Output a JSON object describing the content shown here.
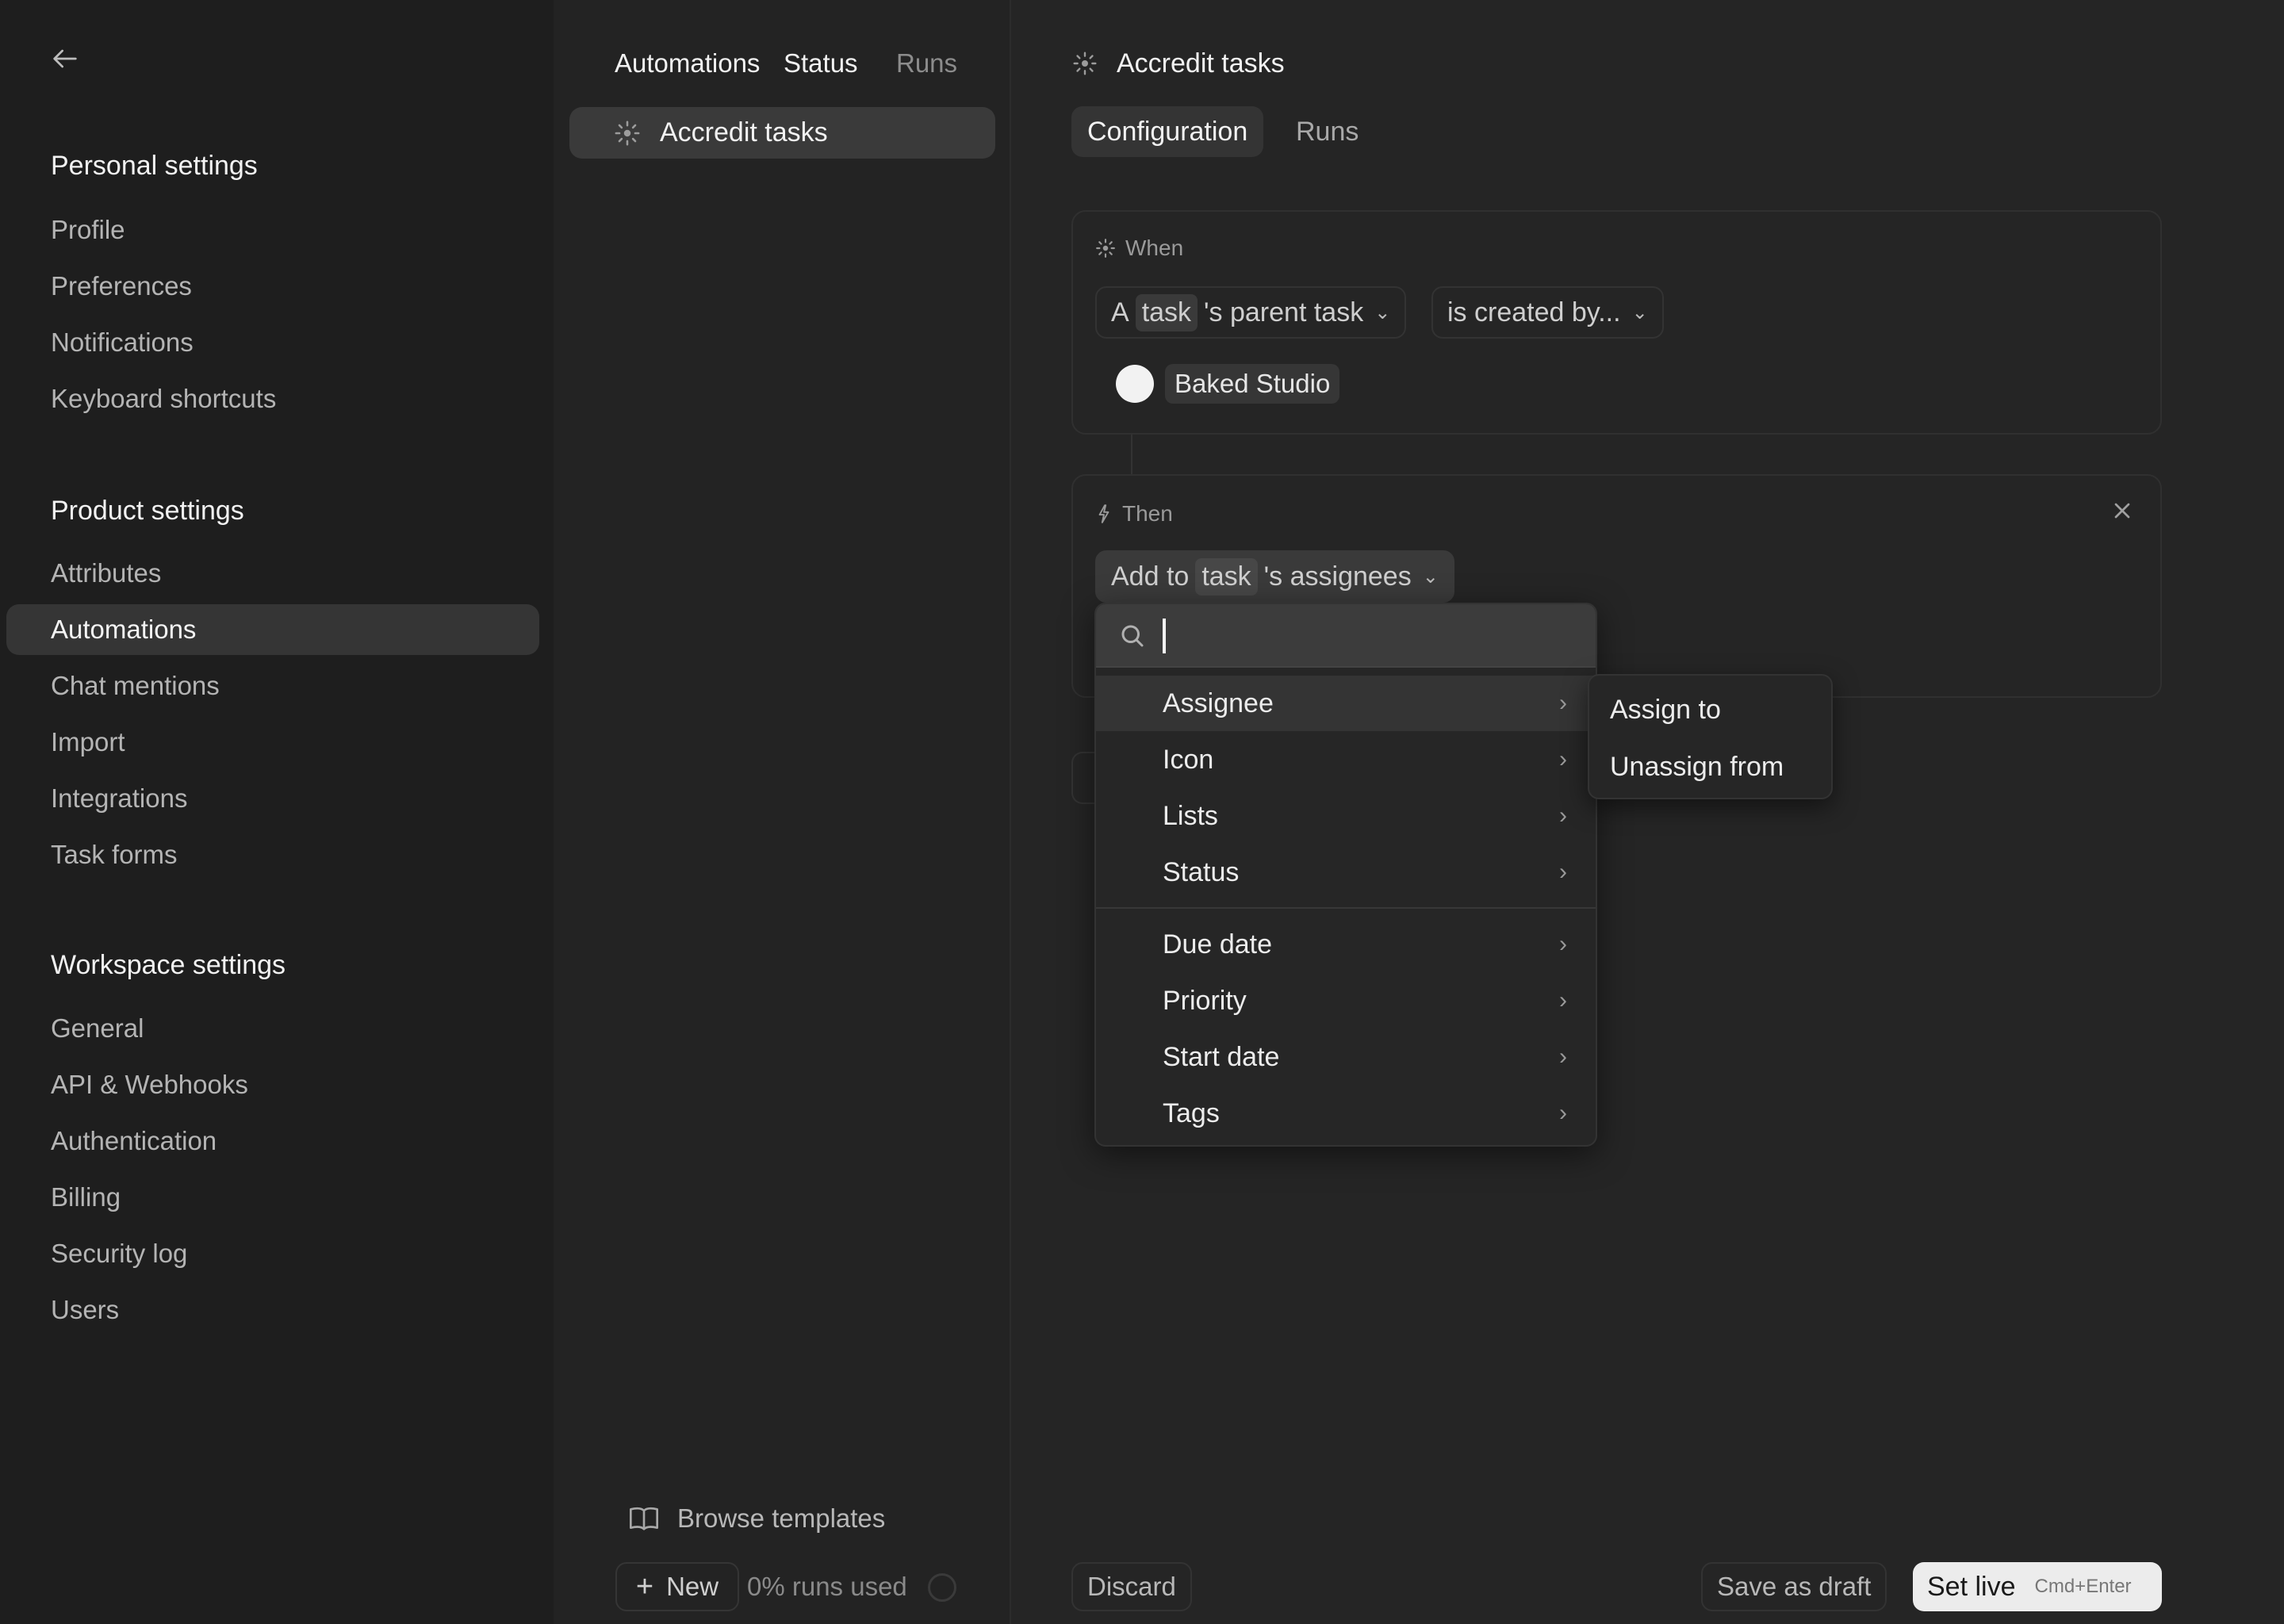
{
  "left_nav": {
    "back_label": "Back",
    "sections": [
      {
        "title": "Personal settings",
        "items": [
          {
            "label": "Profile",
            "active": false
          },
          {
            "label": "Preferences",
            "active": false
          },
          {
            "label": "Notifications",
            "active": false
          },
          {
            "label": "Keyboard shortcuts",
            "active": false
          }
        ]
      },
      {
        "title": "Product settings",
        "items": [
          {
            "label": "Attributes",
            "active": false
          },
          {
            "label": "Automations",
            "active": true
          },
          {
            "label": "Chat mentions",
            "active": false
          },
          {
            "label": "Import",
            "active": false
          },
          {
            "label": "Integrations",
            "active": false
          },
          {
            "label": "Task forms",
            "active": false
          }
        ]
      },
      {
        "title": "Workspace settings",
        "items": [
          {
            "label": "General",
            "active": false
          },
          {
            "label": "API & Webhooks",
            "active": false
          },
          {
            "label": "Authentication",
            "active": false
          },
          {
            "label": "Billing",
            "active": false
          },
          {
            "label": "Security log",
            "active": false
          },
          {
            "label": "Users",
            "active": false
          }
        ]
      }
    ]
  },
  "automations_panel": {
    "tabs": [
      "Automations",
      "Status",
      "Runs"
    ],
    "items": [
      {
        "label": "Accredit tasks",
        "icon": "sun-icon",
        "selected": true
      }
    ],
    "browse_templates": "Browse templates",
    "new_button": "New",
    "runs_used": "0% runs used",
    "runs_used_percent": 0
  },
  "editor": {
    "title": "Accredit tasks",
    "tabs": [
      {
        "label": "Configuration",
        "active": true
      },
      {
        "label": "Runs",
        "active": false
      }
    ],
    "when": {
      "label": "When",
      "trigger_prefix": "A",
      "trigger_chip": "task",
      "trigger_suffix": "'s parent task",
      "condition": "is created by...",
      "value": "Baked Studio"
    },
    "then": {
      "label": "Then",
      "action_prefix": "Add to",
      "action_chip": "task",
      "action_suffix": "'s assignees"
    },
    "action_menu": {
      "search_value": "",
      "search_placeholder": "",
      "group1": [
        "Assignee",
        "Icon",
        "Lists",
        "Status"
      ],
      "group2": [
        "Due date",
        "Priority",
        "Start date",
        "Tags"
      ],
      "highlighted": "Assignee",
      "submenu": [
        "Assign to",
        "Unassign from"
      ]
    },
    "footer": {
      "discard": "Discard",
      "save_draft": "Save as draft",
      "set_live": "Set live",
      "set_live_shortcut": "Cmd+Enter"
    }
  }
}
